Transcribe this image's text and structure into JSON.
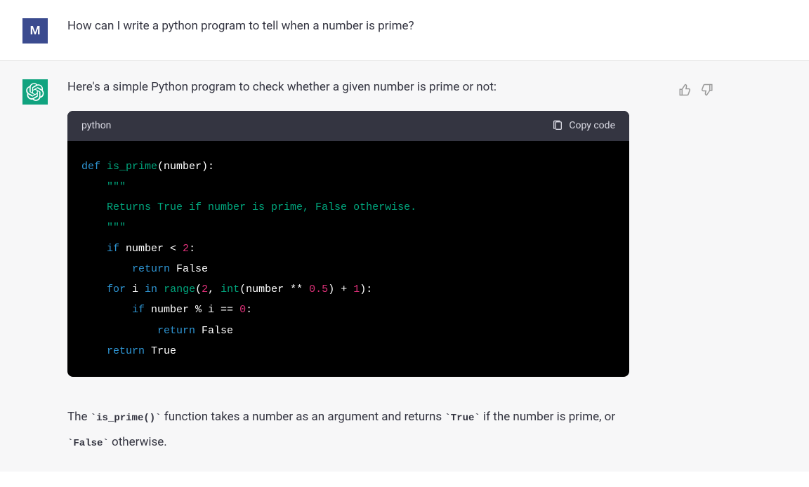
{
  "user": {
    "avatar_letter": "M",
    "message": "How can I write a python program to tell when a number is prime?"
  },
  "assistant": {
    "intro": "Here's a simple Python program to check whether a given number is prime or not:",
    "code": {
      "language": "python",
      "copy_label": "Copy code",
      "tokens": {
        "def": "def",
        "func_name": "is_prime",
        "param_open": "(number):",
        "doc_open": "    \"\"\"",
        "doc_line": "    Returns True if number is prime, False otherwise.",
        "doc_close": "    \"\"\"",
        "if1": "if",
        "cond1_a": " number < ",
        "num2": "2",
        "colon1": ":",
        "return1": "return",
        "false1": " False",
        "for": "for",
        "i": " i ",
        "in": "in",
        "range": " range",
        "paren_open": "(",
        "two": "2",
        "comma": ", ",
        "int": "int",
        "expr_open": "(number ** ",
        "half": "0.5",
        "expr_close": ") + ",
        "one": "1",
        "paren_close": "):",
        "if2": "if",
        "cond2": " number % i == ",
        "zero": "0",
        "colon2": ":",
        "return2": "return",
        "false2": " False",
        "return3": "return",
        "true": " True"
      }
    },
    "explanation": {
      "p1_a": "The ",
      "p1_code1": "`is_prime()`",
      "p1_b": " function takes a number as an argument and returns ",
      "p1_code2": "`True`",
      "p1_c": " if the number is prime, or ",
      "p1_code3": "`False`",
      "p1_d": " otherwise."
    }
  }
}
